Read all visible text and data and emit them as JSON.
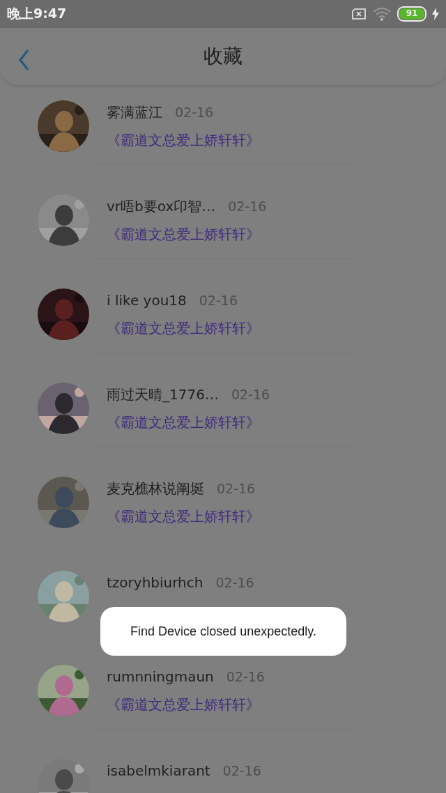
{
  "status_bar": {
    "time": "晚上9:47",
    "battery": "91"
  },
  "header": {
    "title": "收藏"
  },
  "rows": [
    {
      "name": "雾满蓝江",
      "date": "02-16",
      "subtitle": "《霸道文总爱上娇轩轩》"
    },
    {
      "name": "vr唔b要ox卬智…",
      "date": "02-16",
      "subtitle": "《霸道文总爱上娇轩轩》"
    },
    {
      "name": "i like you18",
      "date": "02-16",
      "subtitle": "《霸道文总爱上娇轩轩》"
    },
    {
      "name": "雨过天晴_1776…",
      "date": "02-16",
      "subtitle": "《霸道文总爱上娇轩轩》"
    },
    {
      "name": "麦克樵林说阐埏",
      "date": "02-16",
      "subtitle": "《霸道文总爱上娇轩轩》"
    },
    {
      "name": "tzoryhbiurhch",
      "date": "02-16"
    },
    {
      "name": "rumnningmaun",
      "date": "02-16",
      "subtitle": "《霸道文总爱上娇轩轩》"
    },
    {
      "name": "isabelmkiarant",
      "date": "02-16"
    }
  ],
  "toast": {
    "message": "Find Device closed unexpectedly."
  }
}
